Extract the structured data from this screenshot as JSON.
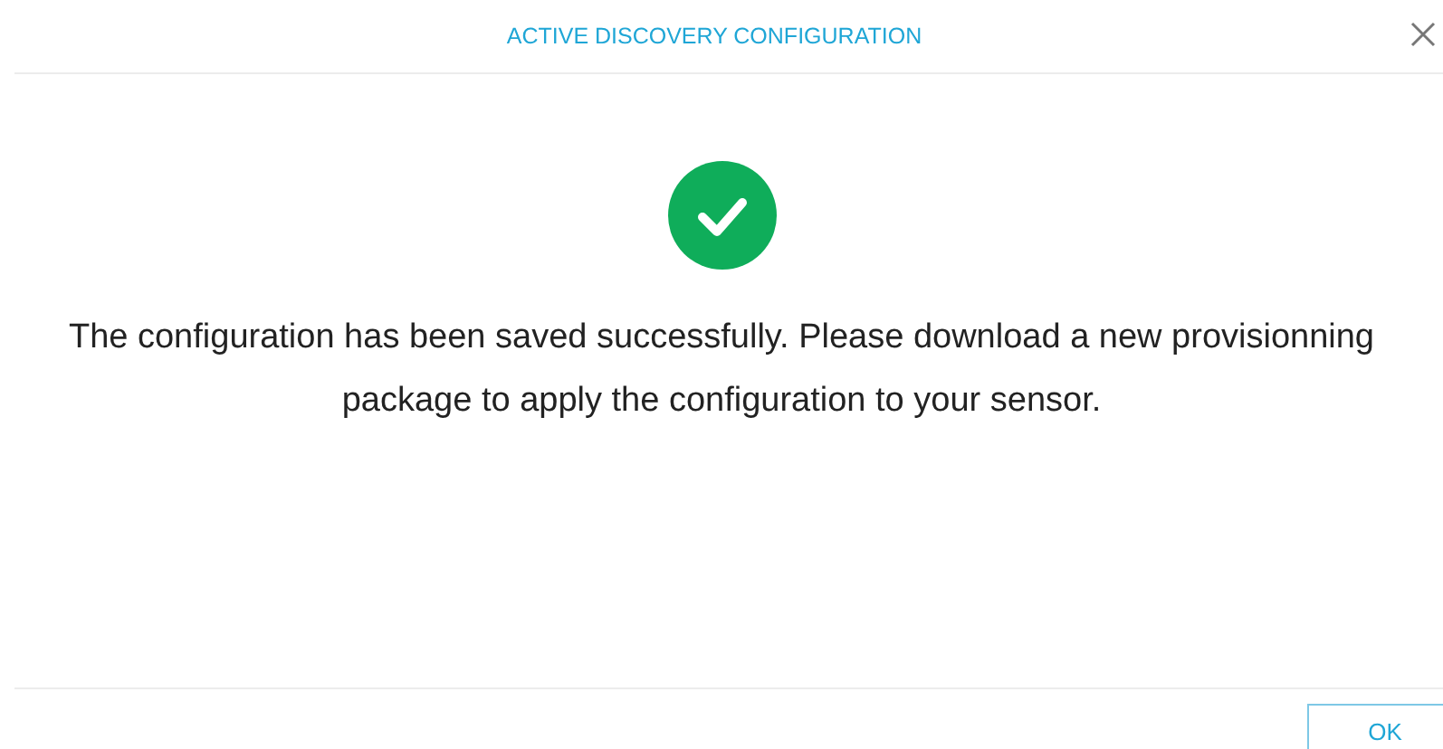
{
  "dialog": {
    "title": "ACTIVE DISCOVERY CONFIGURATION",
    "success": true,
    "message": "The configuration has been saved successfully. Please download a new provisionning package to apply the configuration to your sensor.",
    "buttons": [
      {
        "label": "OK"
      }
    ]
  }
}
